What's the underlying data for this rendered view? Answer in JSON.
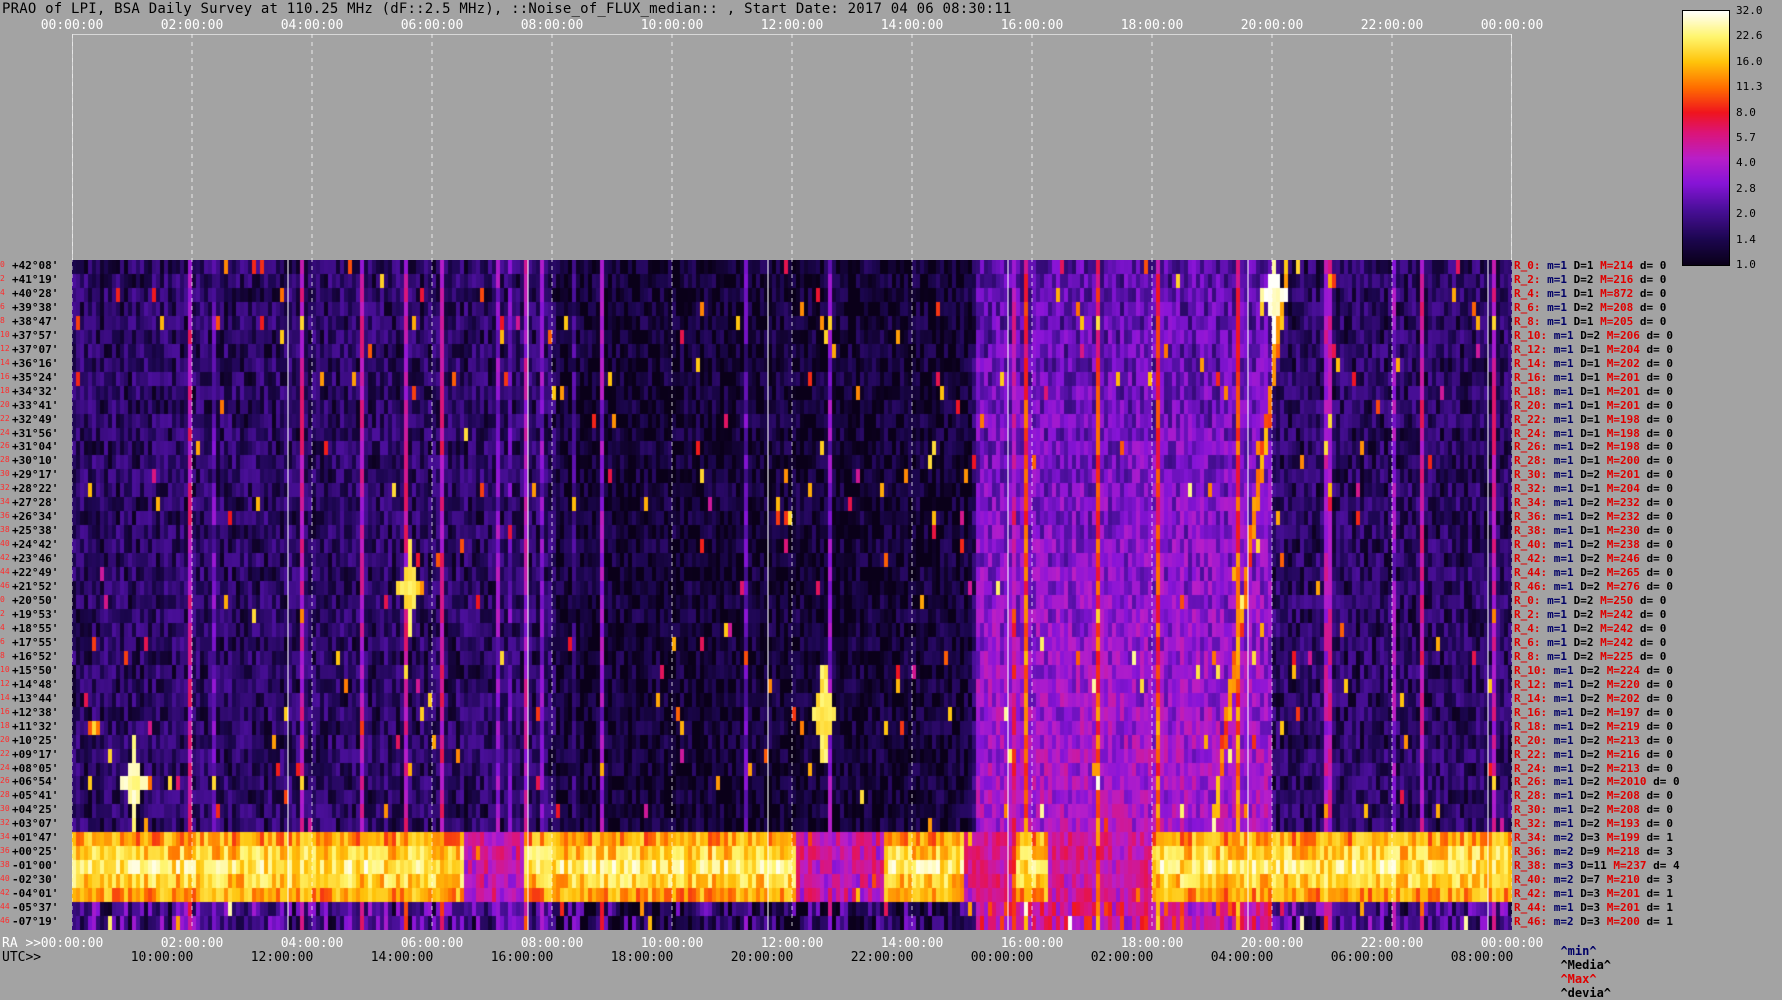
{
  "title": "PRAO of LPI, BSA Daily Survey at 110.25 MHz (dF::2.5 MHz), ::Noise_of_FLUX_median:: , Start Date: 2017 04 06 08:30:11",
  "top_time_labels": [
    "00:00:00",
    "02:00:00",
    "04:00:00",
    "06:00:00",
    "08:00:00",
    "10:00:00",
    "12:00:00",
    "14:00:00",
    "16:00:00",
    "18:00:00",
    "20:00:00",
    "22:00:00",
    "00:00:00"
  ],
  "ra_prefix": "RA >>",
  "ra_labels": [
    "00:00:00",
    "02:00:00",
    "04:00:00",
    "06:00:00",
    "08:00:00",
    "10:00:00",
    "12:00:00",
    "14:00:00",
    "16:00:00",
    "18:00:00",
    "20:00:00",
    "22:00:00",
    "00:00:00"
  ],
  "utc_prefix": "UTC>>",
  "utc_labels": [
    "10:00:00",
    "12:00:00",
    "14:00:00",
    "16:00:00",
    "18:00:00",
    "20:00:00",
    "22:00:00",
    "00:00:00",
    "02:00:00",
    "04:00:00",
    "06:00:00",
    "08:00:00"
  ],
  "row_indices": [
    "0",
    "2",
    "4",
    "6",
    "8",
    "10",
    "12",
    "14",
    "16",
    "18",
    "20",
    "22",
    "24",
    "26",
    "28",
    "30",
    "32",
    "34",
    "36",
    "38",
    "40",
    "42",
    "44",
    "46",
    "0",
    "2",
    "4",
    "6",
    "8",
    "10",
    "12",
    "14",
    "16",
    "18",
    "20",
    "22",
    "24",
    "26",
    "28",
    "30",
    "32",
    "34",
    "36",
    "38",
    "40",
    "42",
    "44",
    "46"
  ],
  "declinations": [
    "+42°08'",
    "+41°19'",
    "+40°28'",
    "+39°38'",
    "+38°47'",
    "+37°57'",
    "+37°07'",
    "+36°16'",
    "+35°24'",
    "+34°32'",
    "+33°41'",
    "+32°49'",
    "+31°56'",
    "+31°04'",
    "+30°10'",
    "+29°17'",
    "+28°22'",
    "+27°28'",
    "+26°34'",
    "+25°38'",
    "+24°42'",
    "+23°46'",
    "+22°49'",
    "+21°52'",
    "+20°50'",
    "+19°53'",
    "+18°55'",
    "+17°55'",
    "+16°52'",
    "+15°50'",
    "+14°48'",
    "+13°44'",
    "+12°38'",
    "+11°32'",
    "+10°25'",
    "+09°17'",
    "+08°05'",
    "+06°54'",
    "+05°41'",
    "+04°25'",
    "+03°07'",
    "+01°47'",
    "+00°25'",
    "-01°00'",
    "-02°30'",
    "-04°01'",
    "-05°37'",
    "-07°19'"
  ],
  "stats": [
    {
      "r": "R_0:",
      "m": "m=1",
      "d": "D=1",
      "M": "M=214",
      "dev": "d= 0"
    },
    {
      "r": "R_2:",
      "m": "m=1",
      "d": "D=2",
      "M": "M=216",
      "dev": "d= 0"
    },
    {
      "r": "R_4:",
      "m": "m=1",
      "d": "D=1",
      "M": "M=872",
      "dev": "d= 0"
    },
    {
      "r": "R_6:",
      "m": "m=1",
      "d": "D=2",
      "M": "M=208",
      "dev": "d= 0"
    },
    {
      "r": "R_8:",
      "m": "m=1",
      "d": "D=1",
      "M": "M=205",
      "dev": "d= 0"
    },
    {
      "r": "R_10:",
      "m": "m=1",
      "d": "D=2",
      "M": "M=206",
      "dev": "d= 0"
    },
    {
      "r": "R_12:",
      "m": "m=1",
      "d": "D=1",
      "M": "M=204",
      "dev": "d= 0"
    },
    {
      "r": "R_14:",
      "m": "m=1",
      "d": "D=1",
      "M": "M=202",
      "dev": "d= 0"
    },
    {
      "r": "R_16:",
      "m": "m=1",
      "d": "D=1",
      "M": "M=201",
      "dev": "d= 0"
    },
    {
      "r": "R_18:",
      "m": "m=1",
      "d": "D=1",
      "M": "M=201",
      "dev": "d= 0"
    },
    {
      "r": "R_20:",
      "m": "m=1",
      "d": "D=1",
      "M": "M=201",
      "dev": "d= 0"
    },
    {
      "r": "R_22:",
      "m": "m=1",
      "d": "D=1",
      "M": "M=198",
      "dev": "d= 0"
    },
    {
      "r": "R_24:",
      "m": "m=1",
      "d": "D=1",
      "M": "M=198",
      "dev": "d= 0"
    },
    {
      "r": "R_26:",
      "m": "m=1",
      "d": "D=2",
      "M": "M=198",
      "dev": "d= 0"
    },
    {
      "r": "R_28:",
      "m": "m=1",
      "d": "D=1",
      "M": "M=200",
      "dev": "d= 0"
    },
    {
      "r": "R_30:",
      "m": "m=1",
      "d": "D=2",
      "M": "M=201",
      "dev": "d= 0"
    },
    {
      "r": "R_32:",
      "m": "m=1",
      "d": "D=1",
      "M": "M=204",
      "dev": "d= 0"
    },
    {
      "r": "R_34:",
      "m": "m=1",
      "d": "D=2",
      "M": "M=232",
      "dev": "d= 0"
    },
    {
      "r": "R_36:",
      "m": "m=1",
      "d": "D=2",
      "M": "M=232",
      "dev": "d= 0"
    },
    {
      "r": "R_38:",
      "m": "m=1",
      "d": "D=1",
      "M": "M=230",
      "dev": "d= 0"
    },
    {
      "r": "R_40:",
      "m": "m=1",
      "d": "D=2",
      "M": "M=238",
      "dev": "d= 0"
    },
    {
      "r": "R_42:",
      "m": "m=1",
      "d": "D=2",
      "M": "M=246",
      "dev": "d= 0"
    },
    {
      "r": "R_44:",
      "m": "m=1",
      "d": "D=2",
      "M": "M=265",
      "dev": "d= 0"
    },
    {
      "r": "R_46:",
      "m": "m=1",
      "d": "D=2",
      "M": "M=276",
      "dev": "d= 0"
    },
    {
      "r": "R_0:",
      "m": "m=1",
      "d": "D=2",
      "M": "M=250",
      "dev": "d= 0"
    },
    {
      "r": "R_2:",
      "m": "m=1",
      "d": "D=2",
      "M": "M=242",
      "dev": "d= 0"
    },
    {
      "r": "R_4:",
      "m": "m=1",
      "d": "D=2",
      "M": "M=242",
      "dev": "d= 0"
    },
    {
      "r": "R_6:",
      "m": "m=1",
      "d": "D=2",
      "M": "M=242",
      "dev": "d= 0"
    },
    {
      "r": "R_8:",
      "m": "m=1",
      "d": "D=2",
      "M": "M=225",
      "dev": "d= 0"
    },
    {
      "r": "R_10:",
      "m": "m=1",
      "d": "D=2",
      "M": "M=224",
      "dev": "d= 0"
    },
    {
      "r": "R_12:",
      "m": "m=1",
      "d": "D=2",
      "M": "M=220",
      "dev": "d= 0"
    },
    {
      "r": "R_14:",
      "m": "m=1",
      "d": "D=2",
      "M": "M=202",
      "dev": "d= 0"
    },
    {
      "r": "R_16:",
      "m": "m=1",
      "d": "D=2",
      "M": "M=197",
      "dev": "d= 0"
    },
    {
      "r": "R_18:",
      "m": "m=1",
      "d": "D=2",
      "M": "M=219",
      "dev": "d= 0"
    },
    {
      "r": "R_20:",
      "m": "m=1",
      "d": "D=2",
      "M": "M=213",
      "dev": "d= 0"
    },
    {
      "r": "R_22:",
      "m": "m=1",
      "d": "D=2",
      "M": "M=216",
      "dev": "d= 0"
    },
    {
      "r": "R_24:",
      "m": "m=1",
      "d": "D=2",
      "M": "M=213",
      "dev": "d= 0"
    },
    {
      "r": "R_26:",
      "m": "m=1",
      "d": "D=2",
      "M": "M=2010",
      "dev": "d= 0"
    },
    {
      "r": "R_28:",
      "m": "m=1",
      "d": "D=2",
      "M": "M=208",
      "dev": "d= 0"
    },
    {
      "r": "R_30:",
      "m": "m=1",
      "d": "D=2",
      "M": "M=208",
      "dev": "d= 0"
    },
    {
      "r": "R_32:",
      "m": "m=1",
      "d": "D=2",
      "M": "M=193",
      "dev": "d= 0"
    },
    {
      "r": "R_34:",
      "m": "m=2",
      "d": "D=3",
      "M": "M=199",
      "dev": "d= 1"
    },
    {
      "r": "R_36:",
      "m": "m=2",
      "d": "D=9",
      "M": "M=218",
      "dev": "d= 3"
    },
    {
      "r": "R_38:",
      "m": "m=3",
      "d": "D=11",
      "M": "M=237",
      "dev": "d= 4"
    },
    {
      "r": "R_40:",
      "m": "m=2",
      "d": "D=7",
      "M": "M=210",
      "dev": "d= 3"
    },
    {
      "r": "R_42:",
      "m": "m=1",
      "d": "D=3",
      "M": "M=201",
      "dev": "d= 1"
    },
    {
      "r": "R_44:",
      "m": "m=1",
      "d": "D=3",
      "M": "M=201",
      "dev": "d= 1"
    },
    {
      "r": "R_46:",
      "m": "m=2",
      "d": "D=3",
      "M": "M=200",
      "dev": "d= 1"
    }
  ],
  "legend": {
    "min": "^min^",
    "median": "^Media^",
    "max": "^Max^",
    "dev": "^devia^"
  },
  "colorbar_labels": [
    "32.0",
    "22.6",
    "16.0",
    "11.3",
    "8.0",
    "5.7",
    "4.0",
    "2.8",
    "2.0",
    "1.4",
    "1.0"
  ],
  "colors": {
    "row_index": "#ff2b2b",
    "stat_red": "#e00000",
    "stat_blue": "#000066",
    "background": "#a3a3a3"
  },
  "chart_data": {
    "type": "heatmap",
    "title": "PRAO of LPI, BSA Daily Survey at 110.25 MHz (dF::2.5 MHz), ::Noise_of_FLUX_median:: , Start Date: 2017 04 06 08:30:11",
    "x_axis_top": "00:00:00 - 00:00:00 (2 h steps)",
    "xlabel_ra": "RA",
    "xlabel_utc": "UTC",
    "ra_range_hours": [
      0,
      24
    ],
    "rows": 48,
    "colorbar_range": [
      1.0,
      32.0
    ],
    "colorbar_scale": "log",
    "features": [
      {
        "name": "sun_band",
        "rows": [
          41,
          45
        ],
        "ra_hours": [
          [
            0,
            6.5
          ],
          [
            7.5,
            12
          ],
          [
            13.5,
            14.8
          ],
          [
            15.7,
            16.2
          ],
          [
            18,
            24
          ]
        ],
        "level": 24
      },
      {
        "name": "sun_track",
        "from": {
          "ra": 18.9,
          "row": 43
        },
        "to": {
          "ra": 20.2,
          "row": 1
        },
        "level": 14
      },
      {
        "name": "source_cross_1",
        "ra": 20.0,
        "row": 2,
        "level": 32
      },
      {
        "name": "source_cross_2",
        "ra": 1.0,
        "row": 37,
        "level": 28
      },
      {
        "name": "source_3",
        "ra": 5.6,
        "row": 23,
        "level": 22
      },
      {
        "name": "source_4",
        "ra": 12.5,
        "row": 32,
        "level": 22
      },
      {
        "name": "diffuse_glow",
        "ra": [
          15,
          20
        ],
        "level": 3.5
      }
    ]
  }
}
